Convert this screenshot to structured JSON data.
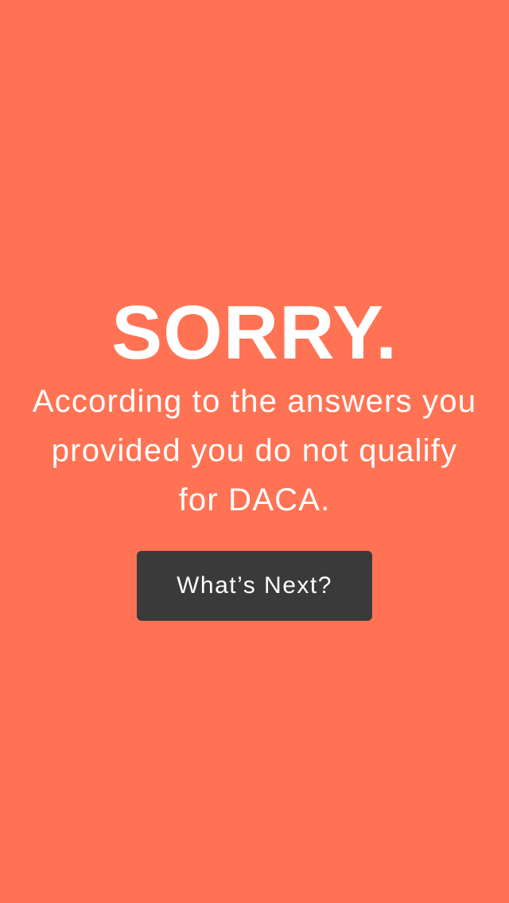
{
  "theme": {
    "background_color": "#FF7354",
    "button_color": "#3A3A3A",
    "text_color": "#FFFFFF"
  },
  "result": {
    "headline": "SORRY.",
    "message": "According to the answers you provided you do not qualify for DACA."
  },
  "actions": {
    "next_label": "What’s Next?"
  }
}
